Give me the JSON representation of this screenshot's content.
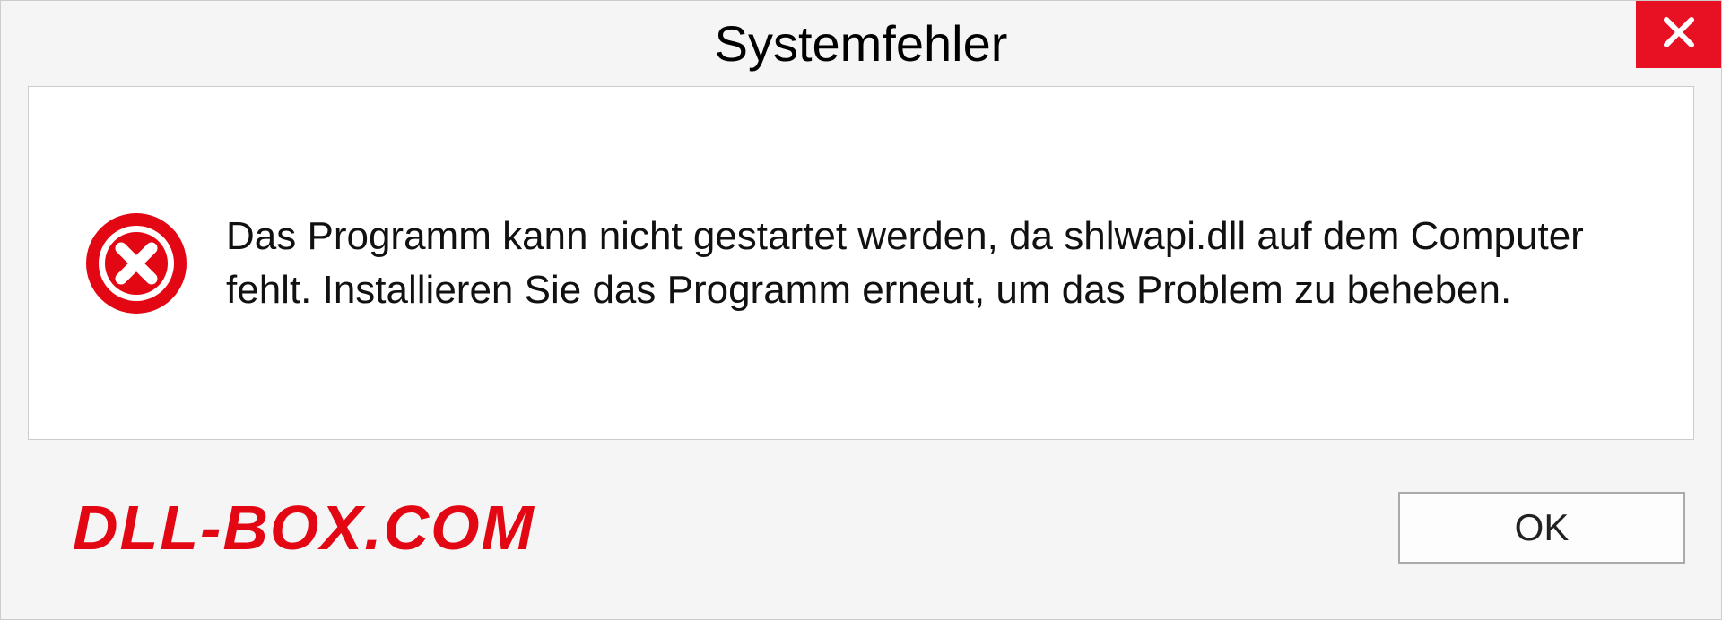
{
  "dialog": {
    "title": "Systemfehler",
    "message": "Das Programm kann nicht gestartet werden, da shlwapi.dll auf dem Computer fehlt. Installieren Sie das Programm erneut, um das Problem zu beheben.",
    "ok_label": "OK"
  },
  "watermark": "DLL-BOX.COM",
  "colors": {
    "close_bg": "#e81123",
    "error_red": "#e30613"
  }
}
